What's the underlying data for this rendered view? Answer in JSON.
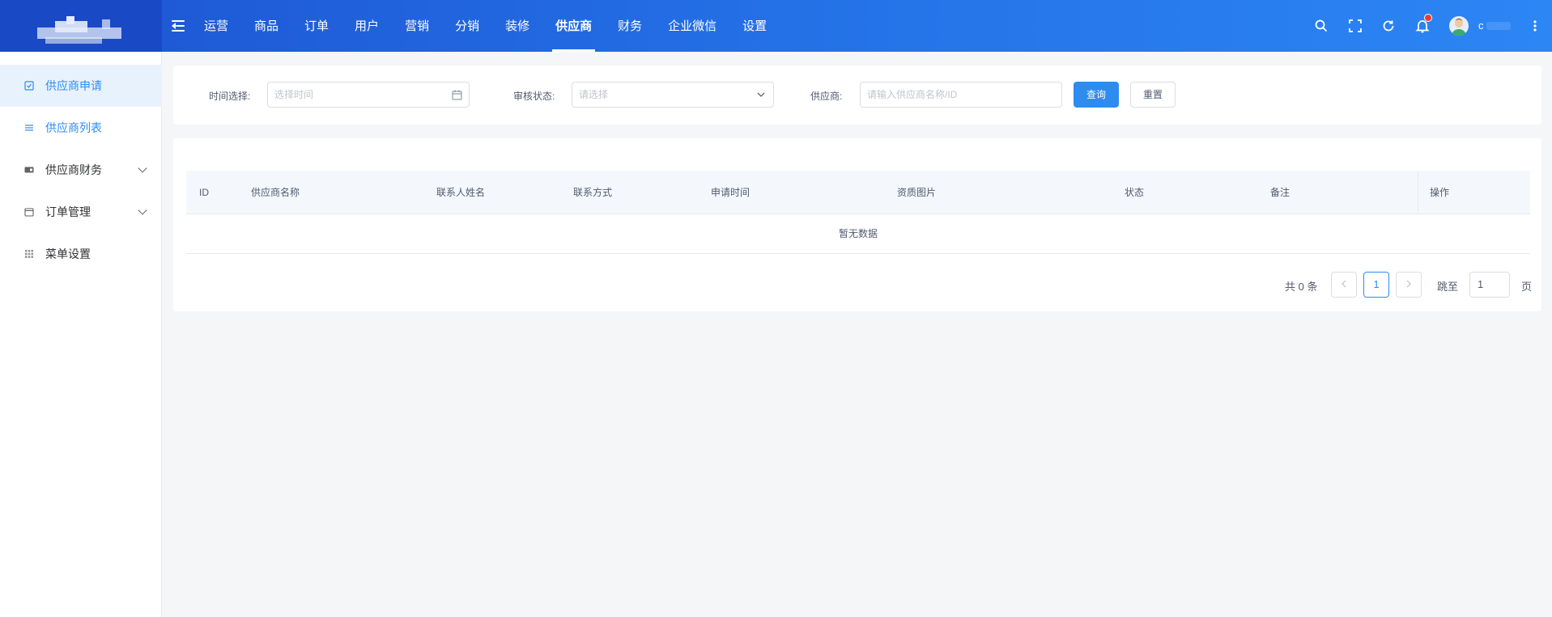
{
  "header": {
    "nav": [
      "运营",
      "商品",
      "订单",
      "用户",
      "营销",
      "分销",
      "装修",
      "供应商",
      "财务",
      "企业微信",
      "设置"
    ],
    "active_nav": "供应商",
    "user_initial": "c"
  },
  "sidebar": {
    "items": [
      {
        "label": "供应商申请",
        "icon": "check-square-icon"
      },
      {
        "label": "供应商列表",
        "icon": "list-icon"
      },
      {
        "label": "供应商财务",
        "icon": "wallet-icon"
      },
      {
        "label": "订单管理",
        "icon": "calendar-icon"
      },
      {
        "label": "菜单设置",
        "icon": "grid-icon"
      }
    ]
  },
  "filters": {
    "time_label": "时间选择:",
    "time_placeholder": "选择时间",
    "status_label": "审核状态:",
    "status_placeholder": "请选择",
    "supplier_label": "供应商:",
    "supplier_placeholder": "请输入供应商名称/ID",
    "query_button": "查询",
    "reset_button": "重置"
  },
  "table": {
    "columns": [
      "ID",
      "供应商名称",
      "联系人姓名",
      "联系方式",
      "申请时间",
      "资质图片",
      "状态",
      "备注",
      "操作"
    ],
    "empty_text": "暂无数据"
  },
  "pagination": {
    "total_text": "共 0 条",
    "current_page": "1",
    "jump_label": "跳至",
    "jump_value": "1",
    "page_unit": "页"
  },
  "colors": {
    "header_start": "#1d54d2",
    "header_end": "#2c86f4",
    "accent": "#2d8cf0",
    "notification_dot": "#f03b2e"
  }
}
